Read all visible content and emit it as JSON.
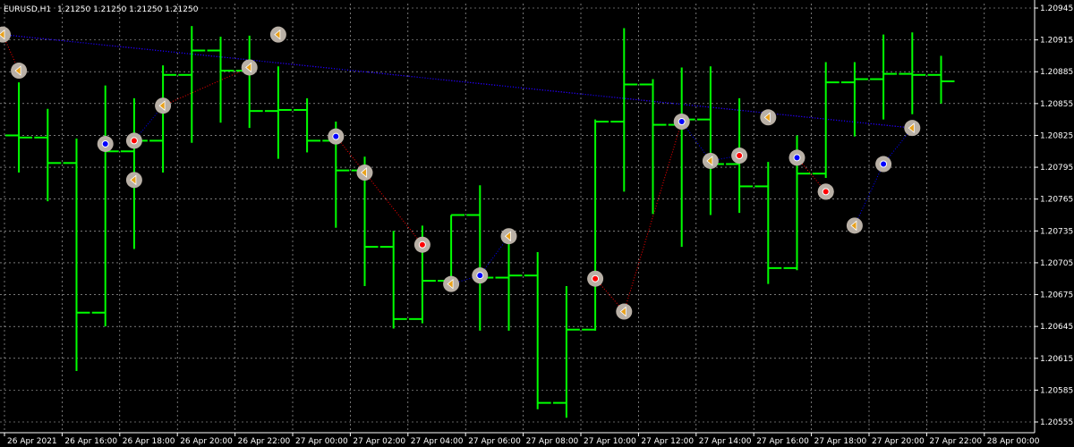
{
  "header": {
    "symbol": "EURUSD,H1",
    "ohlc_text": "1.21250 1.21250 1.21250 1.21250"
  },
  "colors": {
    "background": "#000000",
    "grid": "#c0c0c0",
    "axis": "#ffffff",
    "bar": "#00ff00",
    "marker": "#b9b0a6",
    "marker_down": "#e8a11c",
    "marker_up_dot": "#ff0000",
    "marker_dn_dot": "#0000ff",
    "link_up": "#ff0000",
    "link_dn": "#0000ff"
  },
  "chart_data": {
    "type": "ohlc",
    "title": "EURUSD,H1",
    "y_ticks": [
      "1.20945",
      "1.20915",
      "1.20885",
      "1.20855",
      "1.20825",
      "1.20795",
      "1.20765",
      "1.20735",
      "1.20705",
      "1.20675",
      "1.20645",
      "1.20615",
      "1.20585",
      "1.20555"
    ],
    "ylim": [
      1.20555,
      1.20945
    ],
    "x_ticks": [
      "26 Apr 2021",
      "26 Apr 16:00",
      "26 Apr 18:00",
      "26 Apr 20:00",
      "26 Apr 22:00",
      "27 Apr 00:00",
      "27 Apr 02:00",
      "27 Apr 04:00",
      "27 Apr 06:00",
      "27 Apr 08:00",
      "27 Apr 10:00",
      "27 Apr 12:00",
      "27 Apr 14:00",
      "27 Apr 16:00",
      "27 Apr 18:00",
      "27 Apr 20:00",
      "27 Apr 22:00",
      "28 Apr 00:00"
    ],
    "bars": [
      {
        "o": 1.20825,
        "h": 1.20875,
        "l": 1.2079,
        "c": 1.20823
      },
      {
        "o": 1.20823,
        "h": 1.2085,
        "l": 1.20763,
        "c": 1.20799
      },
      {
        "o": 1.20799,
        "h": 1.20822,
        "l": 1.20603,
        "c": 1.20658
      },
      {
        "o": 1.20658,
        "h": 1.20872,
        "l": 1.20645,
        "c": 1.2081
      },
      {
        "o": 1.2081,
        "h": 1.2086,
        "l": 1.20718,
        "c": 1.2082
      },
      {
        "o": 1.2082,
        "h": 1.20891,
        "l": 1.2079,
        "c": 1.20882
      },
      {
        "o": 1.20882,
        "h": 1.20928,
        "l": 1.20818,
        "c": 1.20905
      },
      {
        "o": 1.20905,
        "h": 1.20918,
        "l": 1.20837,
        "c": 1.20886
      },
      {
        "o": 1.20886,
        "h": 1.20919,
        "l": 1.20832,
        "c": 1.20848
      },
      {
        "o": 1.20848,
        "h": 1.2089,
        "l": 1.20803,
        "c": 1.20849
      },
      {
        "o": 1.20849,
        "h": 1.2086,
        "l": 1.20809,
        "c": 1.2082
      },
      {
        "o": 1.2082,
        "h": 1.20838,
        "l": 1.20738,
        "c": 1.20792
      },
      {
        "o": 1.20792,
        "h": 1.20805,
        "l": 1.20683,
        "c": 1.2072
      },
      {
        "o": 1.2072,
        "h": 1.20735,
        "l": 1.20643,
        "c": 1.20652
      },
      {
        "o": 1.20652,
        "h": 1.2074,
        "l": 1.20648,
        "c": 1.20688
      },
      {
        "o": 1.20688,
        "h": 1.2075,
        "l": 1.20681,
        "c": 1.2075
      },
      {
        "o": 1.2075,
        "h": 1.20778,
        "l": 1.20641,
        "c": 1.20691
      },
      {
        "o": 1.20691,
        "h": 1.2073,
        "l": 1.20641,
        "c": 1.20693
      },
      {
        "o": 1.20693,
        "h": 1.20715,
        "l": 1.20567,
        "c": 1.20573
      },
      {
        "o": 1.20573,
        "h": 1.20683,
        "l": 1.20559,
        "c": 1.20642
      },
      {
        "o": 1.20642,
        "h": 1.2084,
        "l": 1.20641,
        "c": 1.20838
      },
      {
        "o": 1.20838,
        "h": 1.20926,
        "l": 1.20772,
        "c": 1.20873
      },
      {
        "o": 1.20873,
        "h": 1.20878,
        "l": 1.20751,
        "c": 1.20835
      },
      {
        "o": 1.20835,
        "h": 1.20889,
        "l": 1.2072,
        "c": 1.2084
      },
      {
        "o": 1.2084,
        "h": 1.2089,
        "l": 1.2075,
        "c": 1.20798
      },
      {
        "o": 1.20798,
        "h": 1.2086,
        "l": 1.20752,
        "c": 1.20777
      },
      {
        "o": 1.20777,
        "h": 1.208,
        "l": 1.20685,
        "c": 1.207
      },
      {
        "o": 1.207,
        "h": 1.20825,
        "l": 1.20698,
        "c": 1.20789
      },
      {
        "o": 1.20789,
        "h": 1.20894,
        "l": 1.20785,
        "c": 1.20875
      },
      {
        "o": 1.20875,
        "h": 1.20894,
        "l": 1.20824,
        "c": 1.20878
      },
      {
        "o": 1.20878,
        "h": 1.2092,
        "l": 1.2084,
        "c": 1.20883
      },
      {
        "o": 1.20883,
        "h": 1.20922,
        "l": 1.20845,
        "c": 1.20882
      },
      {
        "o": 1.20882,
        "h": 1.209,
        "l": 1.20855,
        "c": 1.20876
      }
    ],
    "markers": [
      {
        "bar": -1,
        "price": 1.2092,
        "kind": "left"
      },
      {
        "bar": 0,
        "price": 1.20886,
        "kind": "left"
      },
      {
        "bar": 3,
        "price": 1.20817,
        "kind": "plus_dn"
      },
      {
        "bar": 4,
        "price": 1.20783,
        "kind": "left"
      },
      {
        "bar": 4,
        "price": 1.2082,
        "kind": "plus_up"
      },
      {
        "bar": 5,
        "price": 1.20853,
        "kind": "left"
      },
      {
        "bar": 8,
        "price": 1.20889,
        "kind": "left"
      },
      {
        "bar": 9,
        "price": 1.2092,
        "kind": "left"
      },
      {
        "bar": 11,
        "price": 1.20824,
        "kind": "plus_dn"
      },
      {
        "bar": 12,
        "price": 1.2079,
        "kind": "left"
      },
      {
        "bar": 14,
        "price": 1.20722,
        "kind": "plus_up"
      },
      {
        "bar": 15,
        "price": 1.20685,
        "kind": "left"
      },
      {
        "bar": 16,
        "price": 1.20693,
        "kind": "plus_dn"
      },
      {
        "bar": 17,
        "price": 1.2073,
        "kind": "left"
      },
      {
        "bar": 20,
        "price": 1.2069,
        "kind": "plus_up"
      },
      {
        "bar": 21,
        "price": 1.20659,
        "kind": "left"
      },
      {
        "bar": 23,
        "price": 1.20838,
        "kind": "plus_dn"
      },
      {
        "bar": 24,
        "price": 1.20801,
        "kind": "left"
      },
      {
        "bar": 25,
        "price": 1.20806,
        "kind": "plus_up"
      },
      {
        "bar": 26,
        "price": 1.20842,
        "kind": "left"
      },
      {
        "bar": 27,
        "price": 1.20804,
        "kind": "plus_dn"
      },
      {
        "bar": 28,
        "price": 1.20772,
        "kind": "left"
      },
      {
        "bar": 28,
        "price": 1.20772,
        "kind": "plus_up"
      },
      {
        "bar": 29,
        "price": 1.2074,
        "kind": "left"
      },
      {
        "bar": 30,
        "price": 1.20798,
        "kind": "plus_dn"
      },
      {
        "bar": 31,
        "price": 1.20832,
        "kind": "left"
      }
    ],
    "links": [
      {
        "from": -1,
        "to": 0,
        "kind": "up"
      },
      {
        "from": 2,
        "to": 3,
        "kind": "dn"
      },
      {
        "from": 3,
        "to": 4,
        "kind": "dn"
      },
      {
        "from": 4,
        "to": 5,
        "kind": "up"
      },
      {
        "from": 7,
        "to": 8,
        "kind": "up"
      },
      {
        "from": 8,
        "to": 9,
        "kind": "up"
      },
      {
        "from": 10,
        "to": 11,
        "kind": "dn"
      },
      {
        "from": 11,
        "to": 12,
        "kind": "dn"
      },
      {
        "from": 13,
        "to": 14,
        "kind": "up"
      },
      {
        "from": 14,
        "to": 15,
        "kind": "up"
      },
      {
        "from": 15,
        "to": 16,
        "kind": "dn"
      },
      {
        "from": 16,
        "to": 17,
        "kind": "dn"
      },
      {
        "from": 19,
        "to": 20,
        "kind": "up"
      },
      {
        "from": 20,
        "to": 21,
        "kind": "up"
      },
      {
        "from": 22,
        "to": 23,
        "kind": "dn"
      },
      {
        "from": 23,
        "to": 24,
        "kind": "dn"
      },
      {
        "from": 24,
        "to": 25,
        "kind": "up"
      },
      {
        "from": 25,
        "to": 26,
        "kind": "up"
      },
      {
        "from": 26,
        "to": 27,
        "kind": "dn"
      },
      {
        "from": 27,
        "to": 28,
        "kind": "dn"
      },
      {
        "from": 28,
        "to": 29,
        "kind": "up"
      },
      {
        "from": 29,
        "to": 30,
        "kind": "dn"
      },
      {
        "from": 30,
        "to": 31,
        "kind": "dn"
      }
    ],
    "grid": true
  }
}
